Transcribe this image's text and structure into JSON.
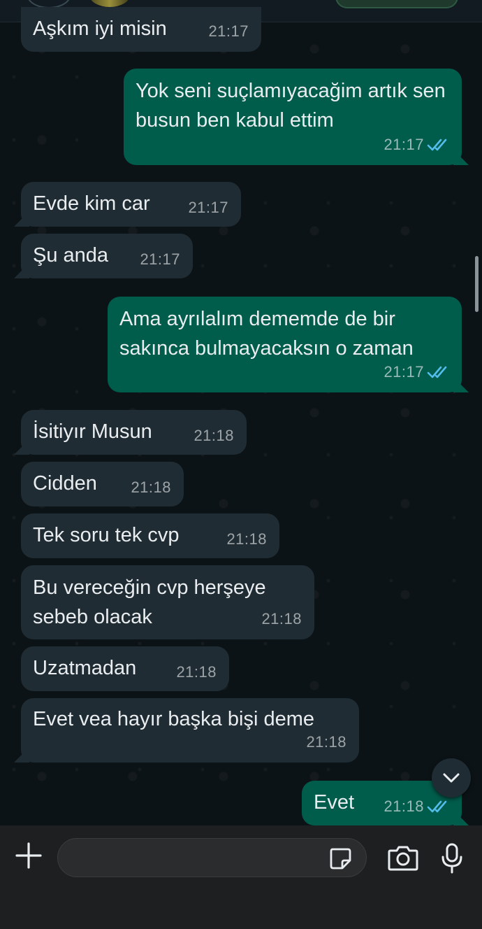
{
  "chat": {
    "messages": [
      {
        "dir": "in",
        "text": "Aşkım iyi misin",
        "time": "21:17"
      },
      {
        "dir": "out",
        "text": "Yok seni suçlamıyacağim artık sen busun ben kabul ettim",
        "time": "21:17",
        "status": "read"
      },
      {
        "dir": "in",
        "text": "Evde kim car",
        "time": "21:17"
      },
      {
        "dir": "in",
        "text": "Şu anda",
        "time": "21:17"
      },
      {
        "dir": "out",
        "text": "Ama ayrılalım dememde de bir sakınca bulmayacaksın o zaman",
        "time": "21:17",
        "status": "read"
      },
      {
        "dir": "in",
        "text": "İsitiyır Musun",
        "time": "21:18"
      },
      {
        "dir": "in",
        "text": "Cidden",
        "time": "21:18"
      },
      {
        "dir": "in",
        "text": "Tek soru tek cvp",
        "time": "21:18"
      },
      {
        "dir": "in",
        "text": "Bu vereceğin cvp herşeye sebeb olacak",
        "time": "21:18"
      },
      {
        "dir": "in",
        "text": "Uzatmadan",
        "time": "21:18"
      },
      {
        "dir": "in",
        "text": "Evet vea hayır başka bişi deme",
        "time": "21:18"
      },
      {
        "dir": "out",
        "text": "Evet",
        "time": "21:18",
        "status": "read"
      }
    ]
  },
  "input": {
    "value": "",
    "placeholder": ""
  },
  "icons": {
    "plus": "plus-icon",
    "sticker": "sticker-icon",
    "camera": "camera-icon",
    "mic": "microphone-icon",
    "scroll": "chevron-down-icon",
    "read": "double-check-icon"
  },
  "colors": {
    "background": "#0c1317",
    "incoming_bubble": "#202c33",
    "outgoing_bubble": "#005c4b",
    "read_ticks": "#53bdeb",
    "input_bar": "#1d1f20"
  }
}
